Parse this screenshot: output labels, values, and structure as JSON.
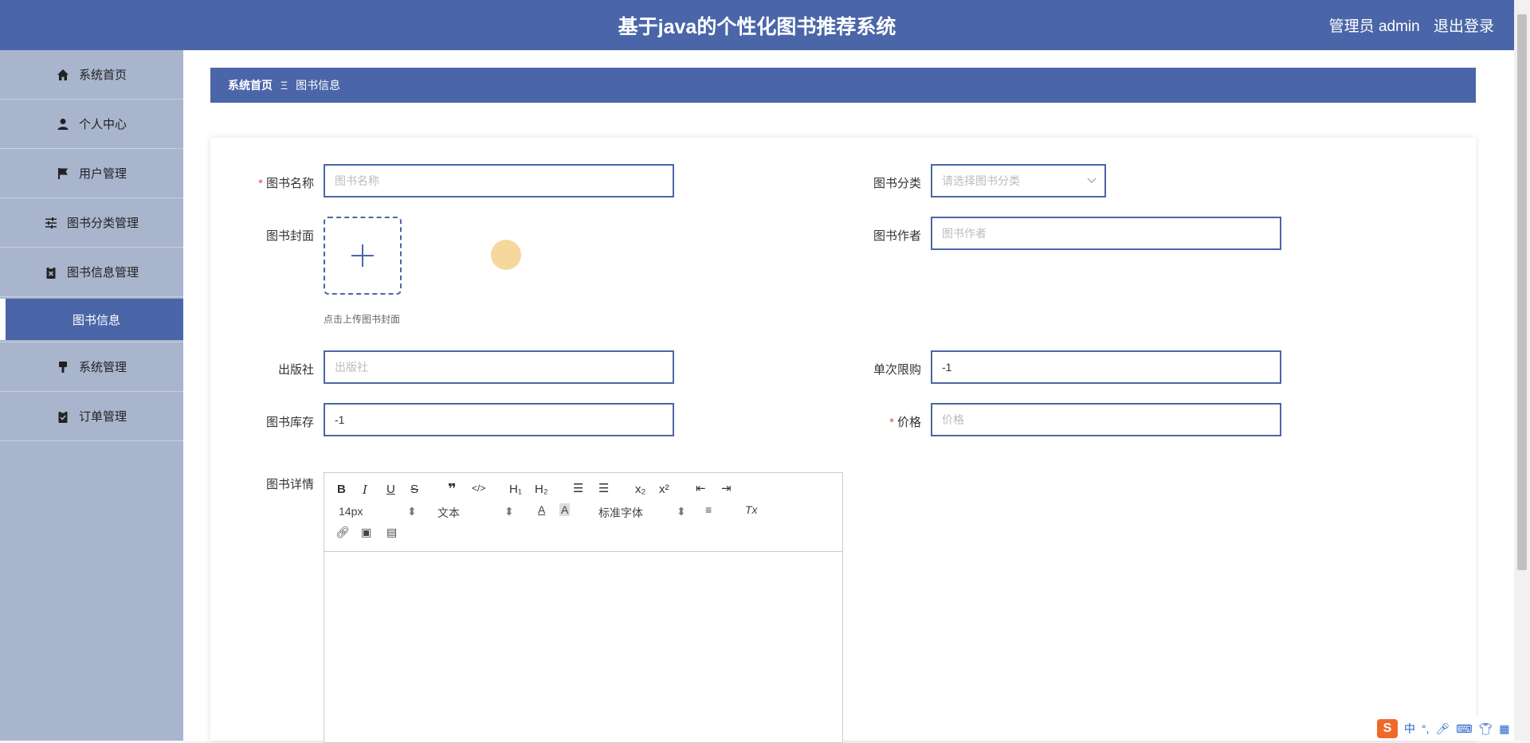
{
  "header": {
    "title": "基于java的个性化图书推荐系统",
    "user_label": "管理员 admin",
    "logout": "退出登录"
  },
  "sidebar": {
    "items": [
      {
        "label": "系统首页",
        "icon": "home-icon"
      },
      {
        "label": "个人中心",
        "icon": "user-icon"
      },
      {
        "label": "用户管理",
        "icon": "flag-icon"
      },
      {
        "label": "图书分类管理",
        "icon": "sliders-icon"
      },
      {
        "label": "图书信息管理",
        "icon": "clipboard-x-icon"
      }
    ],
    "active_sub": "图书信息",
    "items_after": [
      {
        "label": "系统管理",
        "icon": "brush-icon"
      },
      {
        "label": "订单管理",
        "icon": "clipboard-check-icon"
      }
    ]
  },
  "breadcrumb": {
    "home": "系统首页",
    "sep": "Ξ",
    "current": "图书信息"
  },
  "form": {
    "name_label": "图书名称",
    "name_placeholder": "图书名称",
    "category_label": "图书分类",
    "category_placeholder": "请选择图书分类",
    "cover_label": "图书封面",
    "cover_hint": "点击上传图书封面",
    "author_label": "图书作者",
    "author_placeholder": "图书作者",
    "publisher_label": "出版社",
    "publisher_placeholder": "出版社",
    "limit_label": "单次限购",
    "limit_value": "-1",
    "stock_label": "图书库存",
    "stock_value": "-1",
    "price_label": "价格",
    "price_placeholder": "价格",
    "detail_label": "图书详情"
  },
  "editor": {
    "font_size": "14px",
    "block_type": "文本",
    "font_family": "标准字体"
  },
  "ime": {
    "lang": "中"
  }
}
